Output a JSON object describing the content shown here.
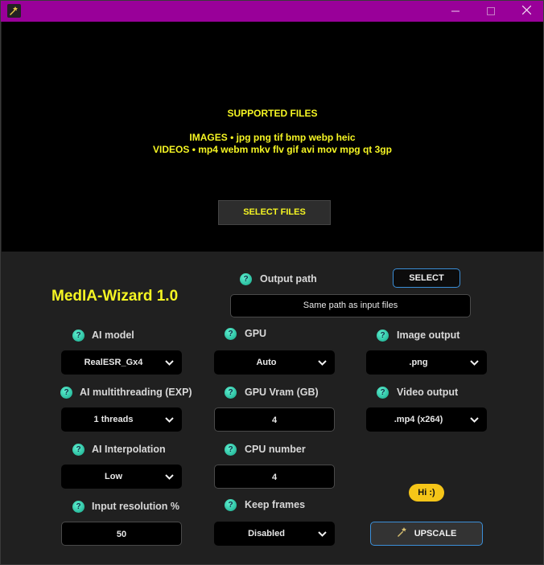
{
  "titlebar": {
    "icons": {
      "app": "app-logo-icon",
      "minimize": "minimize-icon",
      "maximize": "maximize-icon",
      "close": "close-icon"
    }
  },
  "drop_area": {
    "title": "SUPPORTED FILES",
    "images_line": "IMAGES • jpg png tif bmp webp heic",
    "videos_line": "VIDEOS • mp4 webm mkv flv gif avi mov mpg qt 3gp",
    "select_files_label": "SELECT FILES"
  },
  "app": {
    "title": "MedIA-Wizard 1.0"
  },
  "output_path": {
    "label": "Output path",
    "value": "Same path as input files",
    "select_label": "SELECT"
  },
  "settings": {
    "ai_model": {
      "label": "AI model",
      "value": "RealESR_Gx4"
    },
    "ai_multithreading": {
      "label": "AI multithreading (EXP)",
      "value": "1 threads"
    },
    "ai_interpolation": {
      "label": "AI Interpolation",
      "value": "Low"
    },
    "input_resolution": {
      "label": "Input resolution %",
      "value": "50"
    },
    "gpu": {
      "label": "GPU",
      "value": "Auto"
    },
    "gpu_vram": {
      "label": "GPU Vram (GB)",
      "value": "4"
    },
    "cpu_number": {
      "label": "CPU number",
      "value": "4"
    },
    "keep_frames": {
      "label": "Keep frames",
      "value": "Disabled"
    },
    "image_output": {
      "label": "Image output",
      "value": ".png"
    },
    "video_output": {
      "label": "Video output",
      "value": ".mp4 (x264)"
    }
  },
  "help_glyph": "?",
  "hi_badge": "Hi :)",
  "upscale": {
    "label": "UPSCALE"
  },
  "colors": {
    "titlebar": "#990099",
    "accent_yellow": "#f5f523",
    "button_border": "#3b8fd8",
    "help_icon": "#1fc4a0",
    "badge": "#f5c518"
  }
}
